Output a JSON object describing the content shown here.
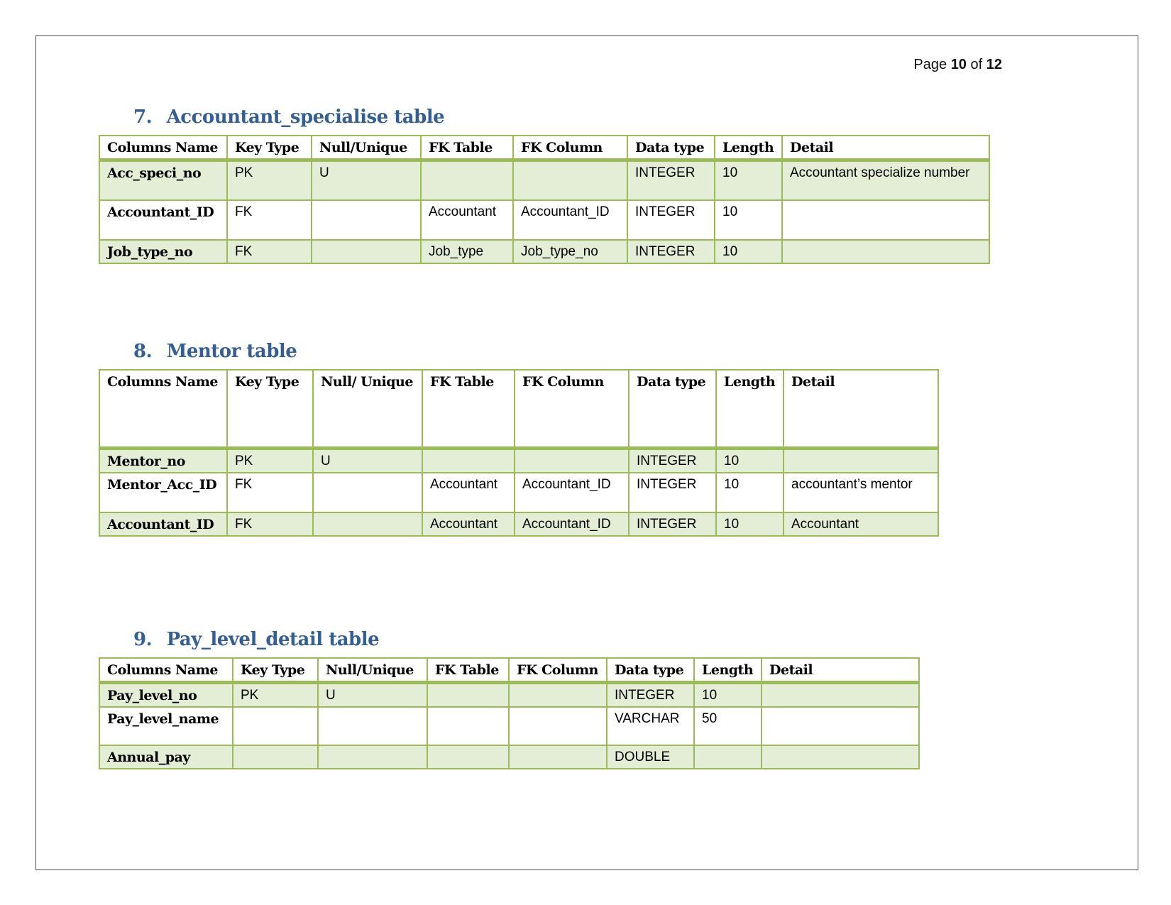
{
  "page": {
    "prefix": "Page",
    "current": "10",
    "of": "of",
    "total": "12"
  },
  "tables": [
    {
      "number": "7.",
      "title": "Accountant_specialise table",
      "headers": [
        "Columns Name",
        "Key Type",
        "Null/Unique",
        "FK Table",
        "FK Column",
        "Data type",
        "Length",
        "Detail"
      ],
      "rows": [
        [
          "Acc_speci_no",
          "PK",
          "U",
          "",
          "",
          "INTEGER",
          "10",
          "Accountant specialize number"
        ],
        [
          "Accountant_ID",
          "FK",
          "",
          "Accountant",
          "Accountant_ID",
          "INTEGER",
          "10",
          ""
        ],
        [
          "Job_type_no",
          "FK",
          "",
          "Job_type",
          "Job_type_no",
          "INTEGER",
          "10",
          ""
        ]
      ]
    },
    {
      "number": "8.",
      "title": "Mentor table",
      "headers": [
        "Columns Name",
        "Key Type",
        "Null/ Unique",
        "FK Table",
        "FK Column",
        "Data type",
        "Length",
        "Detail"
      ],
      "rows": [
        [
          "Mentor_no",
          "PK",
          "U",
          "",
          "",
          "INTEGER",
          "10",
          ""
        ],
        [
          "Mentor_Acc_ID",
          "FK",
          "",
          "Accountant",
          "Accountant_ID",
          "INTEGER",
          "10",
          "accountant’s mentor"
        ],
        [
          "Accountant_ID",
          "FK",
          "",
          "Accountant",
          "Accountant_ID",
          "INTEGER",
          "10",
          "Accountant"
        ]
      ]
    },
    {
      "number": "9.",
      "title": "Pay_level_detail table",
      "headers": [
        "Columns Name",
        "Key Type",
        "Null/Unique",
        "FK Table",
        "FK Column",
        "Data type",
        "Length",
        "Detail"
      ],
      "rows": [
        [
          "Pay_level_no",
          "PK",
          "U",
          "",
          "",
          "INTEGER",
          "10",
          ""
        ],
        [
          "Pay_level_name",
          "",
          "",
          "",
          "",
          "VARCHAR",
          "50",
          ""
        ],
        [
          "Annual_pay",
          "",
          "",
          "",
          "",
          "DOUBLE",
          "",
          ""
        ]
      ]
    }
  ]
}
